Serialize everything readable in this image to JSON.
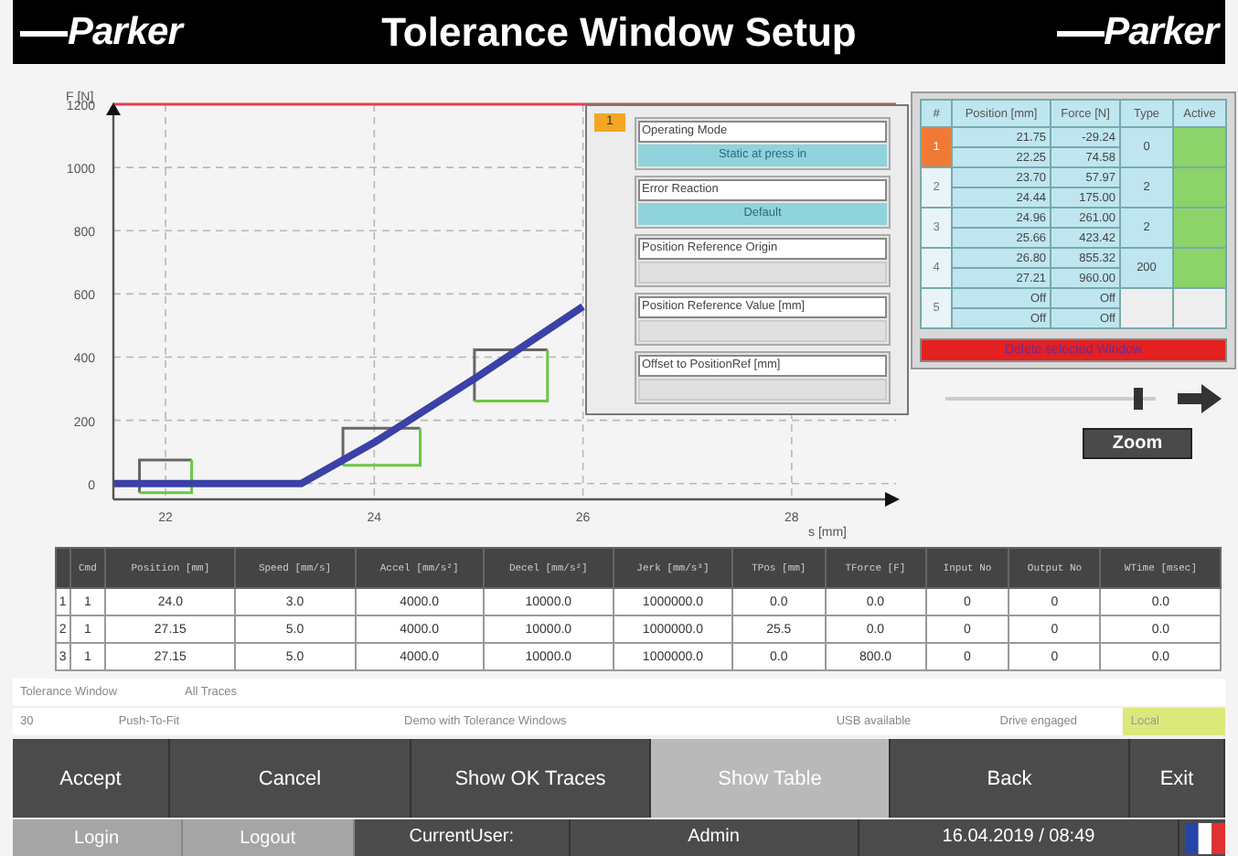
{
  "header": {
    "logo_left": "Parker",
    "title": "Tolerance Window Setup",
    "logo_right": "Parker"
  },
  "chart": {
    "chart_data": {
      "type": "line",
      "xlabel": "s [mm]",
      "ylabel": "F [N]",
      "x": [
        21.5,
        22,
        23,
        23.3,
        24,
        25,
        26
      ],
      "grid": true,
      "series": [
        {
          "color": "#3b41a6",
          "values": [
            0,
            0,
            0,
            0,
            130,
            340,
            560
          ]
        }
      ],
      "xlim": [
        21.5,
        29
      ],
      "ylim": [
        -50,
        1200
      ],
      "xticks": [
        22,
        24,
        26,
        28
      ],
      "yticks": [
        0,
        200,
        400,
        600,
        800,
        1000,
        1200
      ]
    },
    "overlay": {
      "badge": "1",
      "fields": [
        {
          "label": "Operating Mode",
          "value": "Static at press in"
        },
        {
          "label": "Error Reaction",
          "value": "Default"
        },
        {
          "label": "Position Reference Origin"
        },
        {
          "label": "Position Reference Value [mm]"
        },
        {
          "label": "Offset to PositionRef [mm]"
        }
      ]
    }
  },
  "windows_table": {
    "columns": [
      "#",
      "Position [mm]",
      "Force [N]",
      "Type",
      "Active"
    ],
    "rows": [
      {
        "number": "1",
        "selected": true,
        "positions": [
          "21.75",
          "22.25"
        ],
        "forces": [
          "-29.24",
          "74.58"
        ],
        "window_type": "0",
        "active": true
      },
      {
        "number": "2",
        "selected": false,
        "positions": [
          "23.70",
          "24.44"
        ],
        "forces": [
          "57.97",
          "175.00"
        ],
        "window_type": "2",
        "active": true
      },
      {
        "number": "3",
        "selected": false,
        "positions": [
          "24.96",
          "25.66"
        ],
        "forces": [
          "261.00",
          "423.42"
        ],
        "window_type": "2",
        "active": true
      },
      {
        "number": "4",
        "selected": false,
        "positions": [
          "26.80",
          "27.21"
        ],
        "forces": [
          "855.32",
          "960.00"
        ],
        "window_type": "200",
        "active": true
      },
      {
        "number": "5",
        "selected": false,
        "positions": [
          "Off",
          "Off"
        ],
        "forces": [
          "Off",
          "Off"
        ],
        "active": false
      }
    ],
    "delete_button": "Delete selected Window"
  },
  "slider": {
    "level": 0.93
  },
  "zoom_button": "Zoom",
  "motion_table": {
    "columns": [
      "",
      "Cmd",
      "Position [mm]",
      "Speed [mm/s]",
      "Accel [mm/s²]",
      "Decel [mm/s²]",
      "Jerk [mm/s³]",
      "TPos [mm]",
      "TForce [F]",
      "Input No",
      "Output No",
      "WTime [msec]"
    ],
    "rows": [
      [
        "1",
        "1",
        "24.0",
        "3.0",
        "4000.0",
        "10000.0",
        "1000000.0",
        "0.0",
        "0.0",
        "0",
        "0",
        "0.0"
      ],
      [
        "2",
        "1",
        "27.15",
        "5.0",
        "4000.0",
        "10000.0",
        "1000000.0",
        "25.5",
        "0.0",
        "0",
        "0",
        "0.0"
      ],
      [
        "3",
        "1",
        "27.15",
        "5.0",
        "4000.0",
        "10000.0",
        "1000000.0",
        "0.0",
        "800.0",
        "0",
        "0",
        "0.0"
      ]
    ]
  },
  "status": {
    "row_1": [
      "Tolerance Window",
      "All Traces"
    ],
    "row_2": [
      {
        "text": "30",
        "kind": "plain"
      },
      {
        "text": "Push-To-Fit",
        "kind": "plain"
      },
      {
        "text": "Demo with Tolerance Windows",
        "kind": "plain"
      },
      {
        "text": "USB available",
        "kind": "plain"
      },
      {
        "text": "Drive engaged",
        "kind": "plain"
      },
      {
        "text": "Local",
        "kind": "highlight"
      }
    ]
  },
  "buttons": [
    {
      "label": "Accept",
      "selected": false
    },
    {
      "label": "Cancel",
      "selected": false
    },
    {
      "label": "Show OK Traces",
      "selected": false
    },
    {
      "label": "Show Table",
      "selected": true
    },
    {
      "label": "Back",
      "selected": false
    },
    {
      "label": "Exit",
      "selected": false
    }
  ],
  "footer": [
    {
      "text": "Login",
      "kind": "button"
    },
    {
      "text": "Logout",
      "kind": "button"
    },
    {
      "text": "CurrentUser:",
      "kind": "label"
    },
    {
      "text": "Admin",
      "kind": "label"
    },
    {
      "text": "16.04.2019 / 08:49",
      "kind": "label"
    }
  ]
}
